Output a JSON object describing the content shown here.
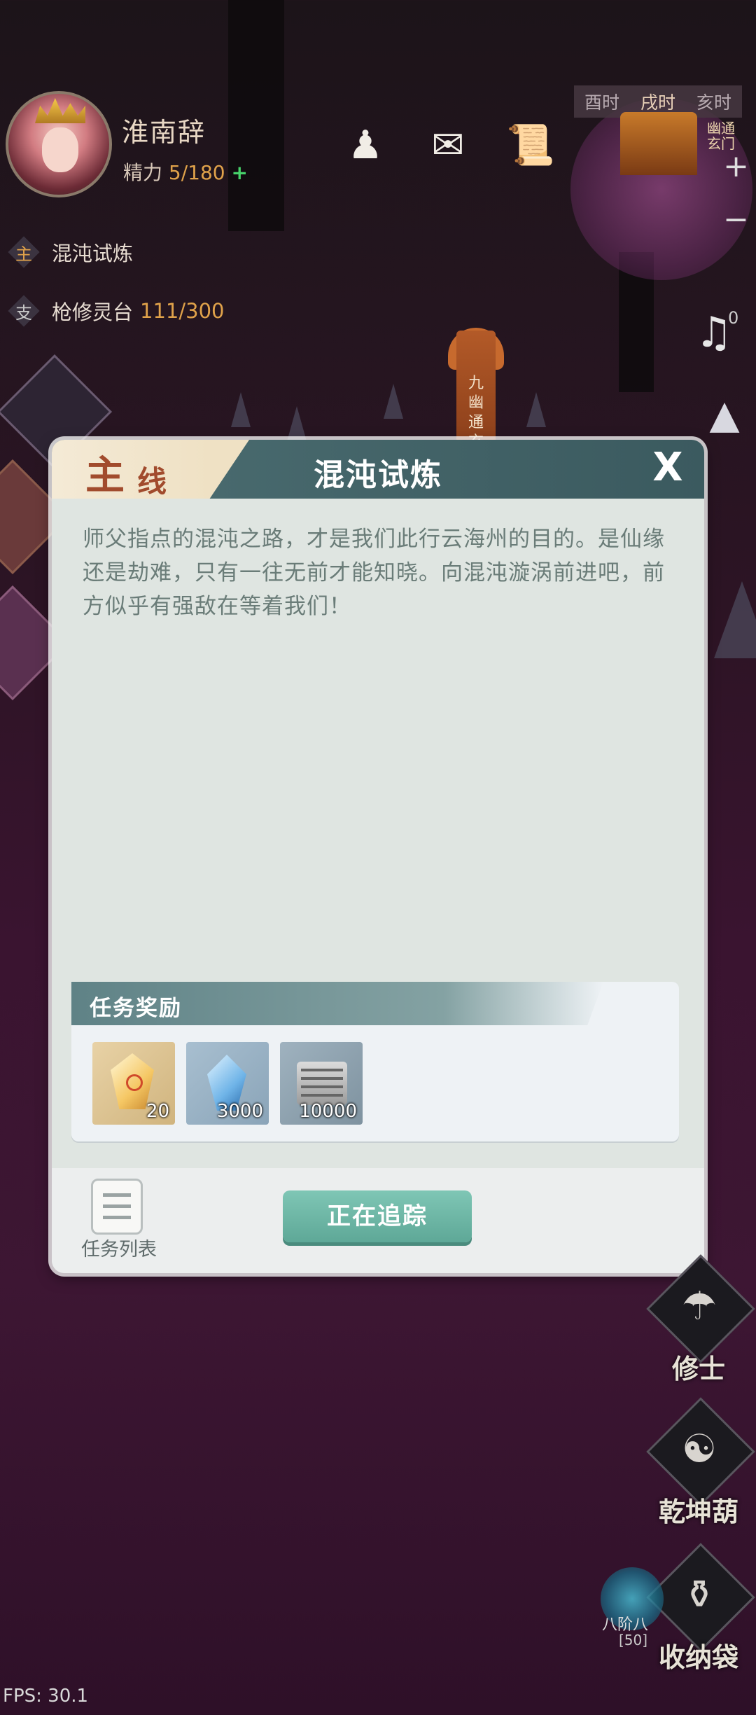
{
  "player": {
    "name": "淮南辞",
    "stamina_label": "精力",
    "stamina_value": "5/180",
    "stamina_add": "+"
  },
  "quests": [
    {
      "tag": "主",
      "name": "混沌试炼",
      "progress": ""
    },
    {
      "tag": "支",
      "name": "枪修灵台",
      "progress": "111/300"
    }
  ],
  "time_bar": [
    "酉时",
    "戌时",
    "亥时"
  ],
  "location_sign": "幽通玄门",
  "signpost": "九幽通玄",
  "zoom": {
    "plus": "+",
    "minus": "−"
  },
  "top_icons": [
    "figure-icon",
    "map-icon",
    "scroll-icon"
  ],
  "dialog": {
    "tag_big": "主",
    "tag_small": "线",
    "title": "混沌试炼",
    "close": "X",
    "body": "师父指点的混沌之路，才是我们此行云海州的目的。是仙缘还是劫难，只有一往无前才能知晓。向混沌漩涡前进吧，前方似乎有强敌在等着我们！",
    "rewards_title": "任务奖励",
    "rewards": [
      {
        "icon": "gold-gem-icon",
        "qty": "20"
      },
      {
        "icon": "blue-crystal-icon",
        "qty": "3000"
      },
      {
        "icon": "scroll-stack-icon",
        "qty": "10000"
      }
    ],
    "list_label": "任务列表",
    "track_button": "正在追踪"
  },
  "right_menu": [
    {
      "label": "修士",
      "icon": "cultivator-icon"
    },
    {
      "label": "乾坤葫",
      "icon": "gourd-icon"
    },
    {
      "label": "收纳袋",
      "icon": "bag-icon"
    }
  ],
  "level_badge": "八阶八",
  "level_badge2": "[50]",
  "side_counter": "0",
  "fps": "FPS: 30.1"
}
